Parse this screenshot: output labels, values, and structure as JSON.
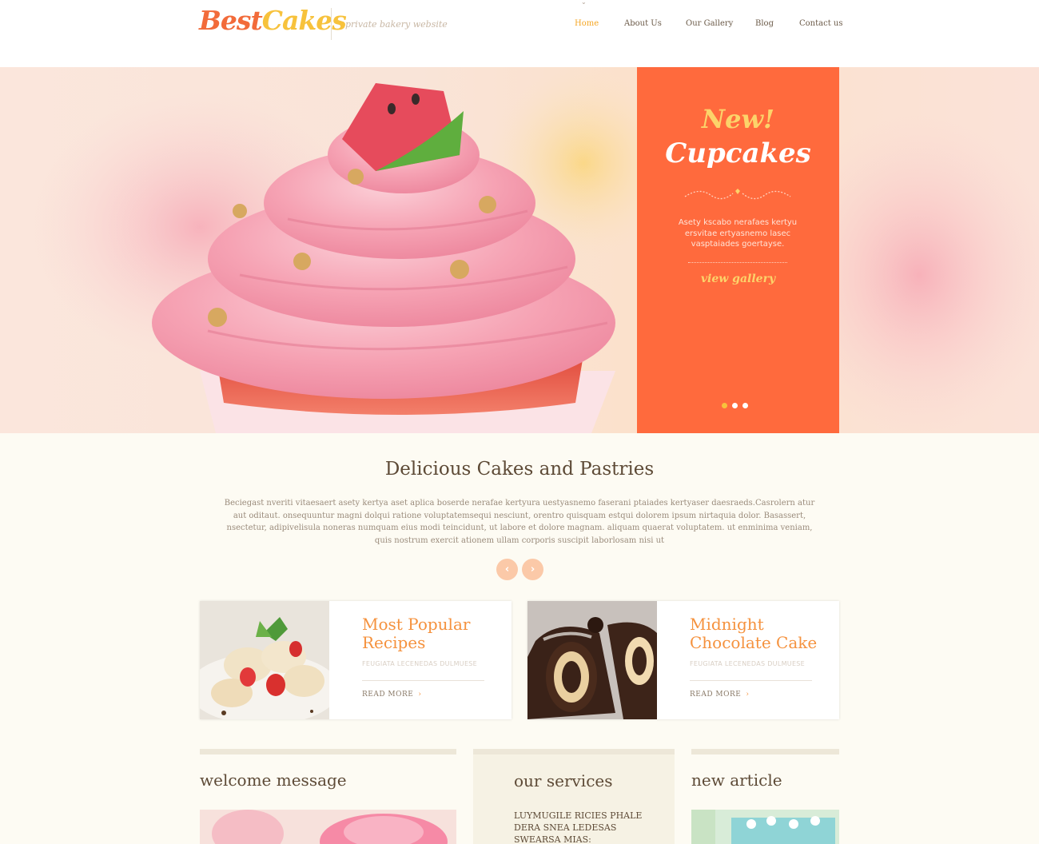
{
  "header": {
    "logo_part1": "Best",
    "logo_part2": "Cakes",
    "tagline": "private bakery website",
    "nav": [
      "Home",
      "About Us",
      "Our Gallery",
      "Blog",
      "Contact us"
    ],
    "active_nav": "Home"
  },
  "slider": {
    "badge": "New!",
    "title": "Cupcakes",
    "text": "Asety kscabo nerafaes kertyu ersvitae ertyasnemo lasec vasptaiades goertayse.",
    "link": "view gallery",
    "slide_count": 3,
    "active_slide": 1
  },
  "intro": {
    "title": "Delicious Cakes and Pastries",
    "text": "Beciegast nveriti vitaesaert asety kertya aset aplica boserde nerafae kertyura uestyasnemo faserani ptaiades kertyaser daesraeds.Casrolern atur aut oditaut. onsequuntur magni dolqui ratione voluptatemsequi nesciunt, orentro quisquam estqui dolorem ipsum nirtaquia dolor. Basassert, nsectetur, adipivelisula noneras numquam eius modi teincidunt, ut labore et dolore magnam. aliquam quaerat voluptatem. ut enminima veniam, quis nostrum exercit ationem ullam corporis suscipit laborlosam nisi ut",
    "prev_icon": "chevron-left-icon",
    "next_icon": "chevron-right-icon"
  },
  "cards": [
    {
      "title": "Most Popular Recipes",
      "subtitle": "FEUGIATA LECENEDAS DULMUESE",
      "more": "READ MORE"
    },
    {
      "title": "Midnight Chocolate Cake",
      "subtitle": "FEUGIATA LECENEDAS DULMUESE",
      "more": "READ MORE"
    }
  ],
  "columns": {
    "welcome_title": "welcome message",
    "services_title": "our services",
    "services_text": "LUYMUGILE RICIES PHALE DERA SNEA LEDESAS SWEARSA MIAS:",
    "article_title": "new article"
  },
  "colors": {
    "accent_orange": "#ff6a3d",
    "accent_yellow": "#f7c23c",
    "title_orange": "#f5923e",
    "background": "#fdfbf3"
  }
}
